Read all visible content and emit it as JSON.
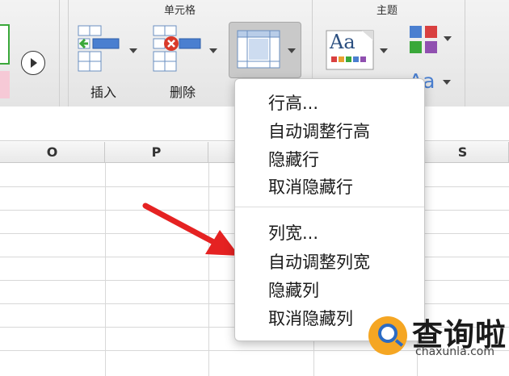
{
  "ribbon": {
    "cells_group_label": "单元格",
    "theme_group_label": "主题",
    "insert_label": "插入",
    "delete_label": "删除",
    "theme_font_label": "Aa",
    "theme_fonts_dropdown_label": "Aa"
  },
  "columns": [
    "O",
    "P",
    "",
    "",
    "S"
  ],
  "menu": {
    "row_items": [
      "行高...",
      "自动调整行高",
      "隐藏行",
      "取消隐藏行"
    ],
    "col_items": [
      "列宽...",
      "自动调整列宽",
      "隐藏列",
      "取消隐藏列"
    ]
  },
  "watermark": {
    "text": "查询啦",
    "url": "chaxunla.com"
  },
  "colors": {
    "arrow": "#e52222",
    "accent_green": "#3aa83a",
    "watermark_orange": "#f5a623",
    "watermark_blue": "#2b6bc4"
  }
}
